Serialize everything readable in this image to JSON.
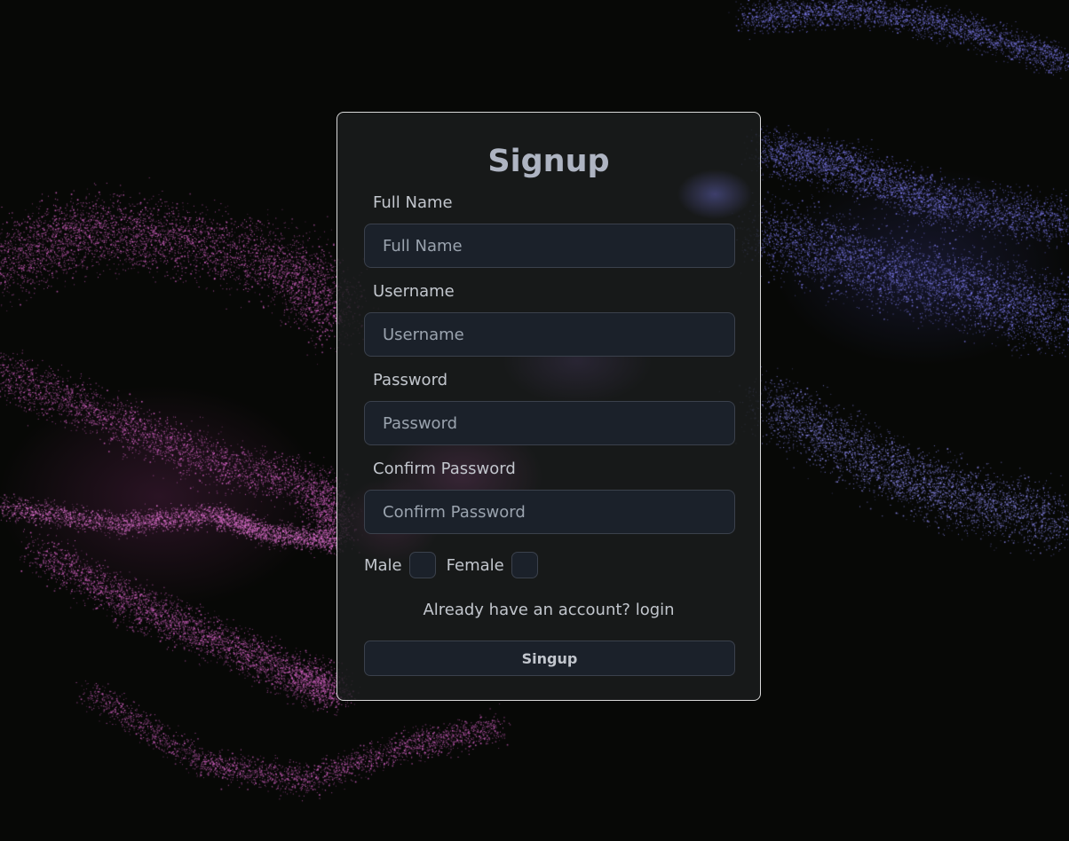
{
  "form": {
    "title": "Signup",
    "fields": [
      {
        "label": "Full Name",
        "placeholder": "Full Name"
      },
      {
        "label": "Username",
        "placeholder": "Username"
      },
      {
        "label": "Password",
        "placeholder": "Password"
      },
      {
        "label": "Confirm Password",
        "placeholder": "Confirm Password"
      }
    ],
    "gender": {
      "male_label": "Male",
      "female_label": "Female"
    },
    "login_link": "Already have an account? login",
    "submit_label": "Singup"
  },
  "colors": {
    "background": "#070806",
    "card": "#1c1e1e",
    "input_bg": "#1b212a",
    "input_border": "#3b414c",
    "title": "#aeb4c2",
    "text": "#c2c6cd",
    "particles_pink": "#d060c0",
    "particles_blue": "#7a78e8"
  }
}
